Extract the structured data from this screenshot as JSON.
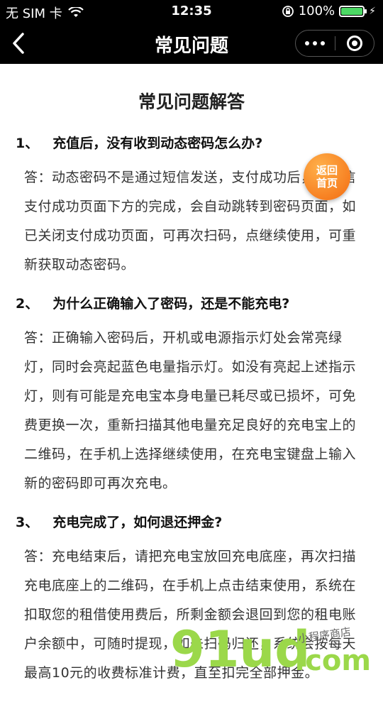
{
  "status": {
    "carrier": "无 SIM 卡",
    "time": "12:35",
    "battery": "100%",
    "battery_level": 1.0
  },
  "nav": {
    "title": "常见问题"
  },
  "page": {
    "heading": "常见问题解答"
  },
  "faq": [
    {
      "num": "1、",
      "question": "充值后，没有收到动态密码怎么办?",
      "answer": "答：动态密码不是通过短信发送，支付成功后，在微信支付成功页面下方的完成，会自动跳转到密码页面，如已关闭支付成功页面，可再次扫码，点继续使用，可重新获取动态密码。"
    },
    {
      "num": "2、",
      "question": "为什么正确输入了密码，还是不能充电?",
      "answer": "答：正确输入密码后，开机或电源指示灯处会常亮绿灯，同时会亮起蓝色电量指示灯。如没有亮起上述指示灯，则有可能是充电宝本身电量已耗尽或已损坏，可免费更换一次，重新扫描其他电量充足良好的充电宝上的二维码，在手机上选择继续使用，在充电宝键盘上输入新的密码即可再次充电。"
    },
    {
      "num": "3、",
      "question": "充电完成了，如何退还押金?",
      "answer": "答：充电结束后，请把充电宝放回充电底座，再次扫描充电底座上的二维码，在手机上点击结束使用，系统在扣取您的租借使用费后，所剩金额会退回到您的租电账户余额中，可随时提现，如未扫码归还，系统会按每天最高10元的收费标准计费，直至扣完全部押金。"
    }
  ],
  "floating": {
    "line1": "返回",
    "line2": "首页"
  },
  "watermark": {
    "brand": "91ud",
    "domain": ".com",
    "tag": "小程序商店"
  }
}
